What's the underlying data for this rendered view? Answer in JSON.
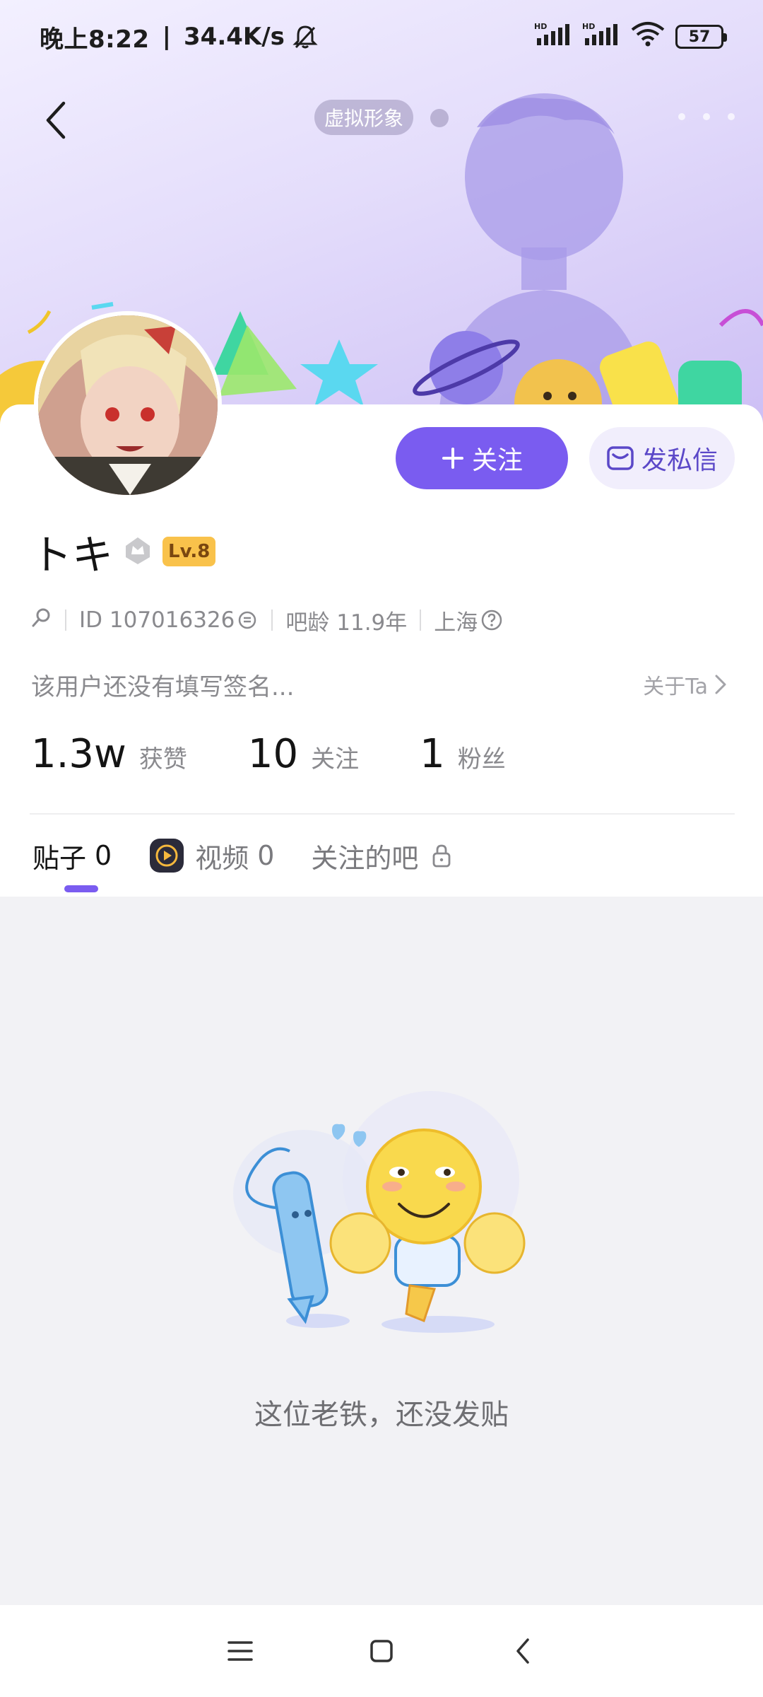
{
  "status_bar": {
    "time": "晚上8:22",
    "separator": "|",
    "net_speed": "34.4K/s",
    "battery": "57"
  },
  "header": {
    "avatar_tag": "虚拟形象"
  },
  "profile": {
    "username": "トキ",
    "level": "Lv.8",
    "id_text": "ID 107016326",
    "bar_age": "吧龄 11.9年",
    "location": "上海",
    "signature": "该用户还没有填写签名...",
    "about_label": "关于Ta"
  },
  "actions": {
    "follow_label": "关注",
    "message_label": "发私信"
  },
  "stats": [
    {
      "value": "1.3w",
      "label": "获赞"
    },
    {
      "value": "10",
      "label": "关注"
    },
    {
      "value": "1",
      "label": "粉丝"
    }
  ],
  "tabs": [
    {
      "label": "贴子",
      "count": "0"
    },
    {
      "label": "视频",
      "count": "0"
    },
    {
      "label": "关注的吧"
    }
  ],
  "empty_state": {
    "message": "这位老铁，还没发贴"
  },
  "colors": {
    "accent": "#7a5cf0",
    "banner": "#d9d0f8",
    "content_bg": "#f2f2f5"
  }
}
